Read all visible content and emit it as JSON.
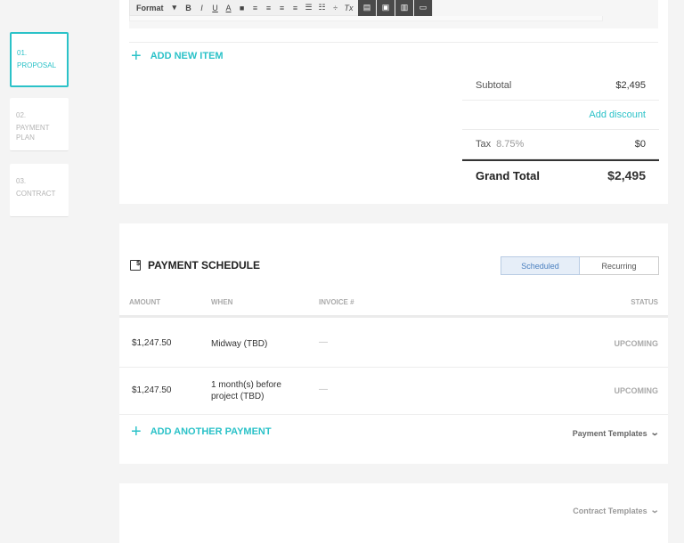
{
  "steps": [
    {
      "num": "01.",
      "label": "PROPOSAL"
    },
    {
      "num": "02.",
      "label": "PAYMENT PLAN"
    },
    {
      "num": "03.",
      "label": "CONTRACT"
    }
  ],
  "toolbar": {
    "format_label": "Format",
    "format_chevron": "▾",
    "bold": "B",
    "italic": "I",
    "underline": "U",
    "font_color": "A",
    "highlight": "■",
    "align_left": "≡",
    "align_center": "≡",
    "align_right": "≡",
    "justify": "≡",
    "bullets": "☰",
    "numbers": "☷",
    "strike": "÷",
    "clear": "Tx",
    "dark1": "▤",
    "dark2": "▣",
    "dark3": "▥",
    "dark4": "▭"
  },
  "proposal": {
    "add_item_label": "ADD NEW ITEM",
    "subtotal_label": "Subtotal",
    "subtotal_value": "$2,495",
    "add_discount_label": "Add discount",
    "tax_label": "Tax",
    "tax_rate": "8.75%",
    "tax_value": "$0",
    "grand_total_label": "Grand Total",
    "grand_total_value": "$2,495"
  },
  "payment_schedule": {
    "title": "PAYMENT SCHEDULE",
    "tab_scheduled": "Scheduled",
    "tab_recurring": "Recurring",
    "columns": {
      "amount": "AMOUNT",
      "when": "WHEN",
      "invoice": "INVOICE #",
      "status": "STATUS"
    },
    "rows": [
      {
        "amount": "$1,247.50",
        "when_line1": "Midway (TBD)",
        "when_line2": "",
        "invoice": "—",
        "status": "UPCOMING"
      },
      {
        "amount": "$1,247.50",
        "when_line1": "1 month(s) before",
        "when_line2": "project (TBD)",
        "invoice": "—",
        "status": "UPCOMING"
      }
    ],
    "add_payment_label": "ADD ANOTHER PAYMENT",
    "templates_label": "Payment Templates"
  },
  "contract": {
    "templates_label": "Contract Templates"
  },
  "colors": {
    "accent": "#2bc2c8",
    "background": "#f4f4f4"
  }
}
